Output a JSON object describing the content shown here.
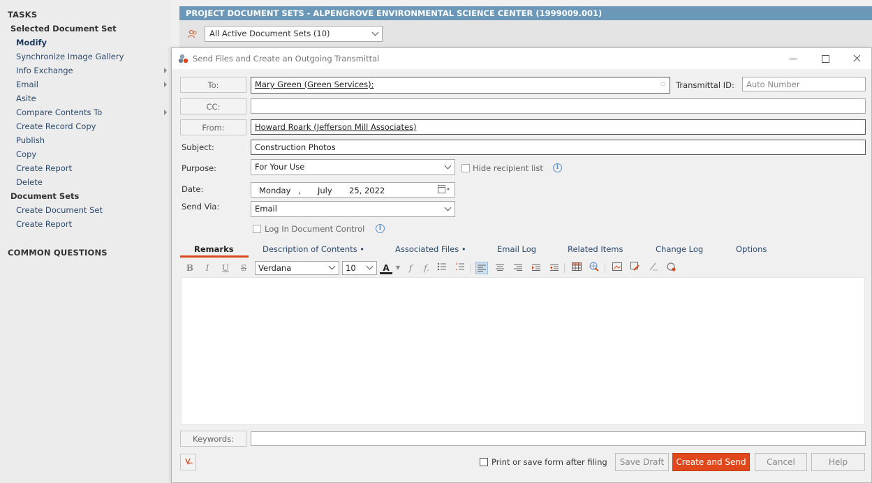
{
  "taskpane": {
    "tasks_heading": "TASKS",
    "selected_heading": "Selected Document Set",
    "items": [
      {
        "label": "Modify"
      },
      {
        "label": "Synchronize Image Gallery"
      },
      {
        "label": "Info Exchange"
      },
      {
        "label": "Email"
      },
      {
        "label": "Asite"
      },
      {
        "label": "Compare Contents To"
      },
      {
        "label": "Create Record Copy"
      },
      {
        "label": "Publish"
      },
      {
        "label": "Copy"
      },
      {
        "label": "Create Report"
      },
      {
        "label": "Delete"
      }
    ],
    "docsets_heading": "Document Sets",
    "docsets_items": [
      {
        "label": "Create Document Set"
      },
      {
        "label": "Create Report"
      }
    ],
    "common_questions": "COMMON QUESTIONS"
  },
  "background": {
    "title": "PROJECT DOCUMENT SETS - ALPENGROVE ENVIRONMENTAL SCIENCE CENTER (1999009.001)",
    "filter_value": "All Active Document Sets (10)"
  },
  "dialog": {
    "title": "Send Files and Create an Outgoing Transmittal",
    "to_label": "To:",
    "to_value": "Mary Green (Green Services);",
    "cc_label": "CC:",
    "cc_value": "",
    "from_label": "From:",
    "from_value": "Howard Roark (Jefferson Mill Associates)",
    "transmittal_label": "Transmittal ID:",
    "transmittal_placeholder": "Auto Number",
    "subject_label": "Subject:",
    "subject_value": "Construction Photos",
    "purpose_label": "Purpose:",
    "purpose_value": "For Your Use",
    "hide_recipient_label": "Hide recipient list",
    "date_label": "Date:",
    "date_weekday": "Monday",
    "date_comma": ",",
    "date_month": "July",
    "date_day_year": "25, 2022",
    "sendvia_label": "Send Via:",
    "sendvia_value": "Email",
    "log_label": "Log In Document Control",
    "tabs": [
      {
        "label": "Remarks"
      },
      {
        "label": "Description of Contents •"
      },
      {
        "label": "Associated Files •"
      },
      {
        "label": "Email Log"
      },
      {
        "label": "Related Items"
      },
      {
        "label": "Change Log"
      },
      {
        "label": "Options"
      }
    ],
    "toolbar": {
      "font_family": "Verdana",
      "font_size": "10",
      "bold": "B",
      "italic": "I",
      "underline": "U",
      "strike": "S",
      "font_color": "A"
    },
    "keywords_label": "Keywords:",
    "keywords_value": "",
    "print_label": "Print or save form after filing",
    "save_draft": "Save Draft",
    "create_send": "Create and Send",
    "cancel": "Cancel",
    "help": "Help"
  },
  "colors": {
    "title_bar": "#6b98b8",
    "accent": "#e0471b",
    "link": "#2b4a6e"
  }
}
